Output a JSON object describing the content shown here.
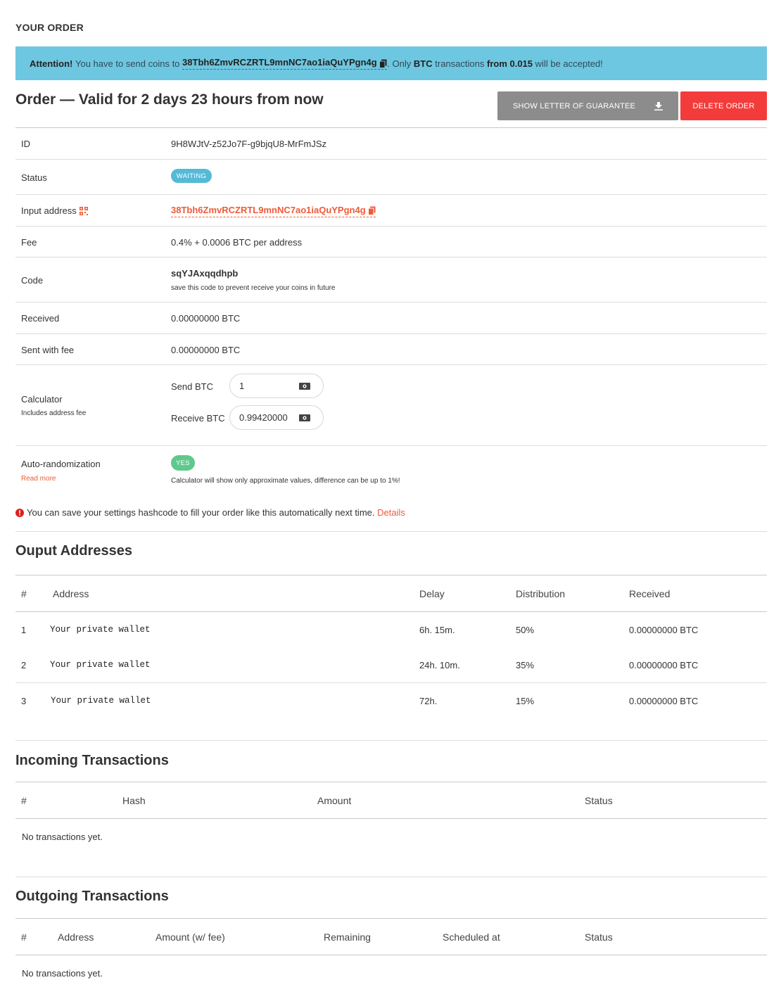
{
  "page": {
    "title": "YOUR ORDER"
  },
  "alert": {
    "lead": "Attention!",
    "text1": "You have to send coins to",
    "address": "38Tbh6ZmvRCZRTL9mnNC7ao1iaQuYPgn4g",
    "text2": ". Only",
    "coin": "BTC",
    "text3": "transactions",
    "from_label": "from 0.015",
    "text4": "will be accepted!",
    "copy_icon": "copy-icon"
  },
  "order": {
    "heading": "Order — Valid for 2 days 23 hours from now",
    "guarantee_button": "SHOW LETTER OF GUARANTEE",
    "guarantee_icon": "download-icon",
    "delete_button": "DELETE ORDER"
  },
  "details": {
    "id_label": "ID",
    "id_value": "9H8WJtV-z52Jo7F-g9bjqU8-MrFmJSz",
    "status_label": "Status",
    "status_value": "WAITING",
    "input_label": "Input address",
    "input_value": "38Tbh6ZmvRCZRTL9mnNC7ao1iaQuYPgn4g",
    "fee_label": "Fee",
    "fee_value": "0.4% + 0.0006 BTC per address",
    "code_label": "Code",
    "code_value": "sqYJAxqqdhpb",
    "code_hint": "save this code to prevent receive your coins in future",
    "received_label": "Received",
    "received_value": "0.00000000 BTC",
    "sent_label": "Sent with fee",
    "sent_value": "0.00000000 BTC",
    "calc_label": "Calculator",
    "calc_hint": "Includes address fee",
    "send_label": "Send BTC",
    "send_value": "1",
    "receive_label": "Receive BTC",
    "receive_value": "0.99420000",
    "auto_label": "Auto-randomization",
    "read_more": "Read more",
    "auto_value": "YES",
    "auto_hint": "Calculator will show only approximate values, difference can be up to 1%!"
  },
  "notice": {
    "text": "You can save your settings hashcode to fill your order like this automatically next time.",
    "link": "Details"
  },
  "outputs": {
    "title": "Ouput Addresses",
    "headers": [
      "#",
      "Address",
      "Delay",
      "Distribution",
      "Received"
    ],
    "rows": [
      {
        "num": "1",
        "address": "Your private wallet",
        "delay": "6h. 15m.",
        "distribution": "50%",
        "received": "0.00000000 BTC"
      },
      {
        "num": "2",
        "address": "Your private wallet",
        "delay": "24h. 10m.",
        "distribution": "35%",
        "received": "0.00000000 BTC"
      },
      {
        "num": "3",
        "address": "Your private wallet",
        "delay": "72h.",
        "distribution": "15%",
        "received": "0.00000000 BTC"
      }
    ]
  },
  "incoming": {
    "title": "Incoming Transactions",
    "headers": [
      "#",
      "Hash",
      "Amount",
      "Status"
    ],
    "empty": "No transactions yet."
  },
  "outgoing": {
    "title": "Outgoing Transactions",
    "headers": [
      "#",
      "Address",
      "Amount (w/ fee)",
      "Remaining",
      "Scheduled at",
      "Status"
    ],
    "empty": "No transactions yet."
  },
  "colors": {
    "alert_bg": "#6ec7e0",
    "accent_red": "#f43b3b",
    "link_orange": "#ee5a36",
    "status_blue": "#55b9d8",
    "yes_green": "#5fc98d"
  }
}
